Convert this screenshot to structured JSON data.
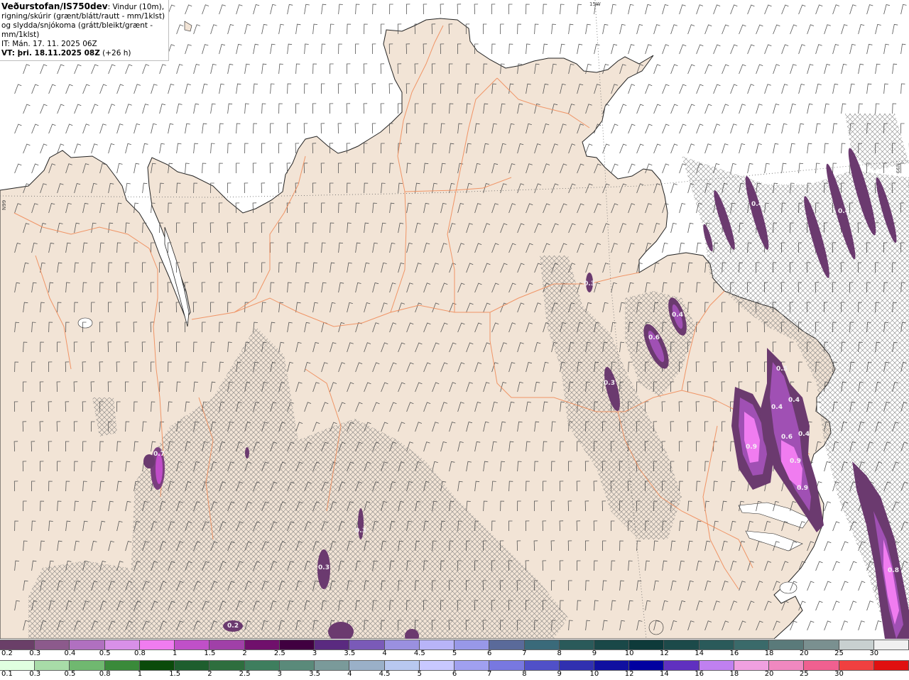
{
  "info": {
    "org": "Veðurstofan/IS750dev",
    "desc": ": Vindur (10m), rigning/skúrir (grænt/blátt/rautt - mm/1klst) og slydda/snjókoma (grátt/bleikt/grænt - mm/1klst)",
    "it": "IT: Mán. 17. 11. 2025 06Z",
    "vt": "VT: þri. 18.11.2025 08Z",
    "vt_suffix": " (+26 h)"
  },
  "grid_labels": {
    "lon": "15W",
    "lat_left": "N99",
    "lat_right": "N99"
  },
  "precip_labels": [
    "0.7",
    "0.3",
    "0.2",
    "0.4",
    "0.6",
    "0.3",
    "0.5",
    "0.4",
    "0.4",
    "0.4",
    "0.9",
    "0.6",
    "0.4",
    "0.9",
    "0.9",
    "0.8",
    "0.4",
    "0.3",
    "0.3"
  ],
  "colors": {
    "land": "#f2e4d6",
    "sea": "#ffffff",
    "roads": "#f08c5a",
    "coast": "#222222",
    "precip_dark": "#6b3a6f",
    "precip_mid": "#a050b4",
    "precip_bright": "#f07cf0"
  },
  "legend_snow": {
    "labels": [
      "0.2",
      "0.3",
      "0.4",
      "0.5",
      "0.8",
      "1",
      "1.5",
      "2",
      "2.5",
      "3",
      "3.5",
      "4",
      "4.5",
      "5",
      "6",
      "7",
      "8",
      "9",
      "10",
      "12",
      "14",
      "16",
      "18",
      "20",
      "25",
      "30"
    ],
    "colors": [
      "#6a3f68",
      "#8c5a8c",
      "#b070c0",
      "#d890e8",
      "#f07cf0",
      "#c050c8",
      "#a040a8",
      "#70106c",
      "#400040",
      "#5a2a80",
      "#7a5ab8",
      "#9a90e0",
      "#b8b4f8",
      "#9898e8",
      "#5a6a9a",
      "#3a6a7a",
      "#2a5a5a",
      "#1a4848",
      "#0e3a3a",
      "#1c4a4a",
      "#2a5a5a",
      "#3a6a6a",
      "#5a7a7a",
      "#7a9090",
      "#c8d0d0",
      "#f0f0f0"
    ]
  },
  "legend_rain": {
    "labels": [
      "0.1",
      "0.3",
      "0.5",
      "0.8",
      "1",
      "1.5",
      "2",
      "2.5",
      "3",
      "3.5",
      "4",
      "4.5",
      "5",
      "6",
      "7",
      "8",
      "9",
      "10",
      "12",
      "14",
      "16",
      "18",
      "20",
      "25",
      "30"
    ],
    "colors": [
      "#e0ffe0",
      "#a8dca8",
      "#70b870",
      "#3a8a3a",
      "#0a4a0a",
      "#1e5e2e",
      "#2e6e3e",
      "#3e7e5e",
      "#5a8a7a",
      "#7a9a9a",
      "#9ab0c8",
      "#b8c8f0",
      "#c8c8ff",
      "#a0a0f0",
      "#7878e0",
      "#5050c8",
      "#3030b0",
      "#1010a0",
      "#0000a0",
      "#6030c0",
      "#c080f0",
      "#f0a0e0",
      "#f088c0",
      "#f06090",
      "#f04040",
      "#e01010"
    ]
  }
}
